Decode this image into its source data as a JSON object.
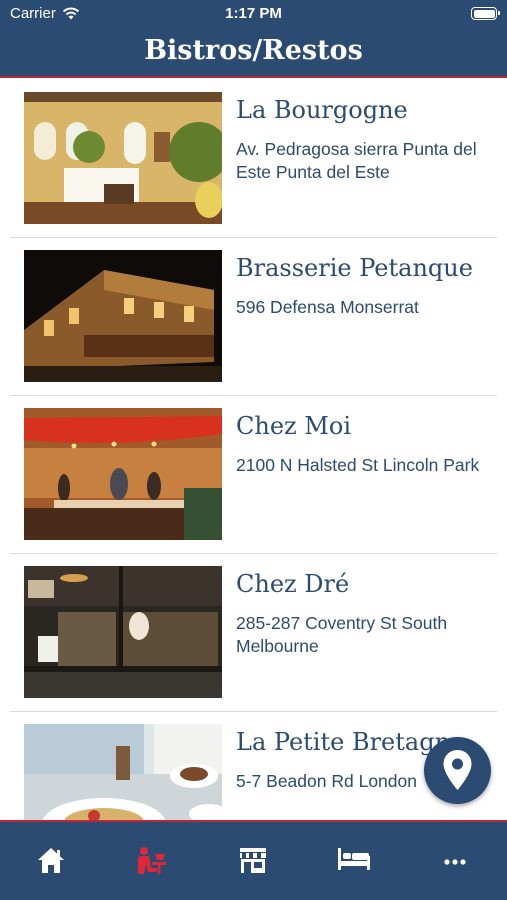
{
  "status_bar": {
    "carrier": "Carrier",
    "time": "1:17 PM"
  },
  "nav": {
    "title": "Bistros/Restos"
  },
  "restaurants": [
    {
      "name": "La Bourgogne",
      "address": "Av. Pedragosa sierra Punta del Este Punta del Este"
    },
    {
      "name": "Brasserie Petanque",
      "address": "596 Defensa Monserrat"
    },
    {
      "name": "Chez Moi",
      "address": "2100 N Halsted St Lincoln Park"
    },
    {
      "name": "Chez Dré",
      "address": "285-287 Coventry St South Melbourne"
    },
    {
      "name": "La Petite Bretagne",
      "address": "5-7 Beadon Rd London"
    }
  ],
  "map_button": {
    "icon": "map-pin-icon"
  },
  "tab_bar": {
    "tabs": [
      {
        "icon": "home-icon",
        "active": false
      },
      {
        "icon": "restaurant-icon",
        "active": true
      },
      {
        "icon": "shop-icon",
        "active": false
      },
      {
        "icon": "bed-icon",
        "active": false
      },
      {
        "icon": "more-icon",
        "active": false
      }
    ]
  },
  "colors": {
    "primary": "#2b4b73",
    "accent": "#c0263a",
    "background": "#ffffff",
    "divider": "#d9d9d9"
  }
}
